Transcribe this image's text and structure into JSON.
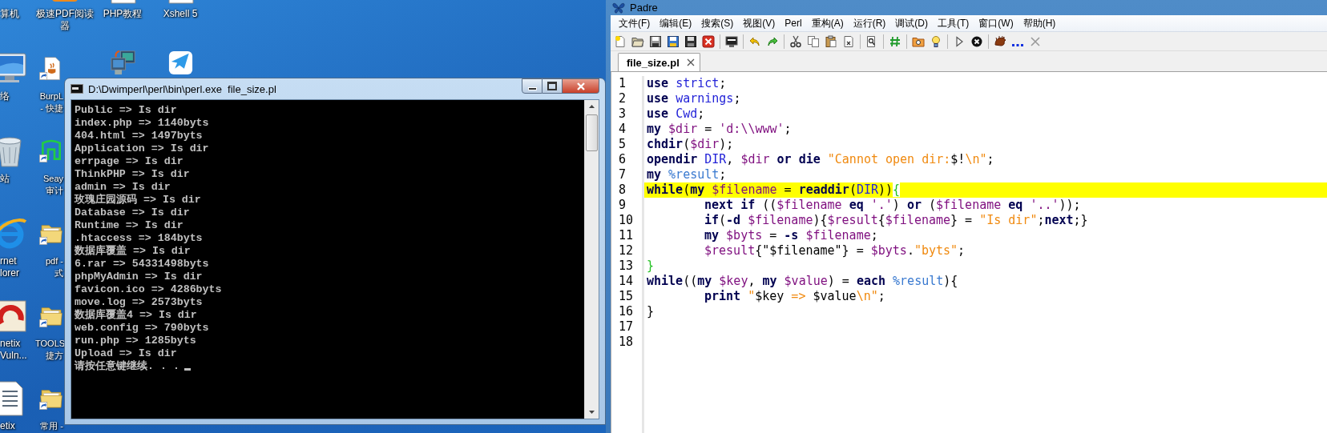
{
  "desktop": {
    "columns": [
      {
        "icons": [
          {
            "label_lines": [
              "算机"
            ]
          },
          {
            "kind": "monitor",
            "label_lines": [
              "络"
            ]
          },
          {
            "kind": "bin",
            "label_lines": [
              "站"
            ]
          },
          {
            "kind": "globe",
            "label_lines": [
              "rnet",
              "lorer"
            ]
          },
          {
            "kind": "red-app",
            "label_lines": [
              "netix",
              "Vuln..."
            ]
          },
          {
            "kind": "document",
            "label_lines": [
              "etix"
            ]
          }
        ]
      },
      {
        "icons": [
          {
            "kind": "pdf-app",
            "shortcut": false,
            "label_lines": [
              "极速PDF阅读",
              "器"
            ]
          },
          {
            "kind": "java-file",
            "shortcut": true,
            "label_lines": [
              "BurpL",
              "- 快捷"
            ]
          },
          {
            "kind": "green-app",
            "shortcut": true,
            "label_lines": [
              "Seay",
              "审计"
            ]
          },
          {
            "kind": "folder",
            "shortcut": true,
            "label_lines": [
              "pdf -",
              "式"
            ]
          },
          {
            "kind": "folder",
            "shortcut": true,
            "label_lines": [
              "TOOLS",
              "捷方"
            ]
          },
          {
            "kind": "folder",
            "shortcut": true,
            "label_lines": [
              "常用 -"
            ]
          }
        ]
      },
      {
        "icons": [
          {
            "kind": "document",
            "label_lines": [
              "PHP教程"
            ]
          },
          {
            "kind": "computer"
          }
        ]
      },
      {
        "icons": [
          {
            "kind": "document",
            "label_lines": [
              "Xshell 5"
            ]
          },
          {
            "kind": "bird"
          }
        ]
      }
    ]
  },
  "console": {
    "title": "D:\\Dwimperl\\perl\\bin\\perl.exe  file_size.pl",
    "cursor": true,
    "lines": [
      "Public => Is dir",
      "index.php => 1140byts",
      "404.html => 1497byts",
      "Application => Is dir",
      "errpage => Is dir",
      "ThinkPHP => Is dir",
      "admin => Is dir",
      "玫瑰庄园源码 => Is dir",
      "Database => Is dir",
      "Runtime => Is dir",
      ".htaccess => 184byts",
      "数据库覆盖 => Is dir",
      "6.rar => 54331498byts",
      "phpMyAdmin => Is dir",
      "favicon.ico => 4286byts",
      "move.log => 2573byts",
      "数据库覆盖4 => Is dir",
      "web.config => 790byts",
      "run.php => 1285byts",
      "Upload => Is dir",
      "请按任意键继续. . ."
    ]
  },
  "padre": {
    "title": "Padre",
    "menu": [
      "文件(F)",
      "编辑(E)",
      "搜索(S)",
      "视图(V)",
      "Perl",
      "重构(A)",
      "运行(R)",
      "调试(D)",
      "工具(T)",
      "窗口(W)",
      "帮助(H)"
    ],
    "tabs": [
      {
        "label": "file_size.pl",
        "selected": true
      }
    ],
    "lines": [
      {
        "number": "1",
        "current": false,
        "indented": false,
        "tokens": [
          {
            "text": "use ",
            "kind": "keyword"
          },
          {
            "text": "strict",
            "kind": "ident"
          },
          {
            "text": ";",
            "kind": "plain"
          }
        ]
      },
      {
        "number": "2",
        "current": false,
        "indented": false,
        "tokens": [
          {
            "text": "use ",
            "kind": "keyword"
          },
          {
            "text": "warnings",
            "kind": "ident"
          },
          {
            "text": ";",
            "kind": "plain"
          }
        ]
      },
      {
        "number": "3",
        "current": false,
        "indented": false,
        "tokens": [
          {
            "text": "use ",
            "kind": "keyword"
          },
          {
            "text": "Cwd",
            "kind": "ident"
          },
          {
            "text": ";",
            "kind": "plain"
          }
        ]
      },
      {
        "number": "4",
        "current": false,
        "indented": false,
        "tokens": [
          {
            "text": "my ",
            "kind": "keyword"
          },
          {
            "text": "$dir",
            "kind": "var"
          },
          {
            "text": " = ",
            "kind": "plain"
          },
          {
            "text": "'d:\\\\www'",
            "kind": "quote"
          },
          {
            "text": ";",
            "kind": "plain"
          }
        ]
      },
      {
        "number": "5",
        "current": false,
        "indented": false,
        "tokens": [
          {
            "text": "chdir",
            "kind": "keyword"
          },
          {
            "text": "(",
            "kind": "plain"
          },
          {
            "text": "$dir",
            "kind": "var"
          },
          {
            "text": ");",
            "kind": "plain"
          }
        ]
      },
      {
        "number": "6",
        "current": false,
        "indented": false,
        "tokens": [
          {
            "text": "opendir ",
            "kind": "keyword"
          },
          {
            "text": "DIR",
            "kind": "ident"
          },
          {
            "text": ", ",
            "kind": "plain"
          },
          {
            "text": "$dir ",
            "kind": "var"
          },
          {
            "text": "or die ",
            "kind": "keyword"
          },
          {
            "text": "\"Cannot open dir:",
            "kind": "string"
          },
          {
            "text": "$!",
            "kind": "plain"
          },
          {
            "text": "\\n\"",
            "kind": "string"
          },
          {
            "text": ";",
            "kind": "plain"
          }
        ]
      },
      {
        "number": "7",
        "current": false,
        "indented": false,
        "tokens": [
          {
            "text": "my ",
            "kind": "keyword"
          },
          {
            "text": "%result",
            "kind": "hash"
          },
          {
            "text": ";",
            "kind": "plain"
          }
        ]
      },
      {
        "number": "8",
        "current": true,
        "indented": false,
        "tokens": [
          {
            "text": "while",
            "kind": "keyword"
          },
          {
            "text": "(",
            "kind": "plain"
          },
          {
            "text": "my ",
            "kind": "keyword"
          },
          {
            "text": "$filename",
            "kind": "var"
          },
          {
            "text": " = ",
            "kind": "plain"
          },
          {
            "text": "readdir",
            "kind": "keyword"
          },
          {
            "text": "(",
            "kind": "plain"
          },
          {
            "text": "DIR",
            "kind": "ident"
          },
          {
            "text": "))",
            "kind": "plain"
          },
          {
            "text": "{",
            "kind": "brace"
          }
        ]
      },
      {
        "number": "9",
        "current": false,
        "indented": true,
        "tokens": [
          {
            "text": "next if",
            "kind": "keyword"
          },
          {
            "text": " ((",
            "kind": "plain"
          },
          {
            "text": "$filename ",
            "kind": "var"
          },
          {
            "text": "eq ",
            "kind": "keyword"
          },
          {
            "text": "'.'",
            "kind": "quote"
          },
          {
            "text": ") ",
            "kind": "plain"
          },
          {
            "text": "or",
            "kind": "keyword"
          },
          {
            "text": " (",
            "kind": "plain"
          },
          {
            "text": "$filename ",
            "kind": "var"
          },
          {
            "text": "eq ",
            "kind": "keyword"
          },
          {
            "text": "'..'",
            "kind": "quote"
          },
          {
            "text": "));",
            "kind": "plain"
          }
        ]
      },
      {
        "number": "10",
        "current": false,
        "indented": true,
        "tokens": [
          {
            "text": "if",
            "kind": "keyword"
          },
          {
            "text": "(",
            "kind": "plain"
          },
          {
            "text": "-d ",
            "kind": "keyword"
          },
          {
            "text": "$filename",
            "kind": "var"
          },
          {
            "text": "){",
            "kind": "plain"
          },
          {
            "text": "$result",
            "kind": "var"
          },
          {
            "text": "{",
            "kind": "plain"
          },
          {
            "text": "$filename",
            "kind": "var"
          },
          {
            "text": "} = ",
            "kind": "plain"
          },
          {
            "text": "\"Is dir\"",
            "kind": "string"
          },
          {
            "text": ";",
            "kind": "plain"
          },
          {
            "text": "next",
            "kind": "keyword"
          },
          {
            "text": ";}",
            "kind": "plain"
          }
        ]
      },
      {
        "number": "11",
        "current": false,
        "indented": true,
        "tokens": [
          {
            "text": "my ",
            "kind": "keyword"
          },
          {
            "text": "$byts",
            "kind": "var"
          },
          {
            "text": " = ",
            "kind": "plain"
          },
          {
            "text": "-s ",
            "kind": "keyword"
          },
          {
            "text": "$filename",
            "kind": "var"
          },
          {
            "text": ";",
            "kind": "plain"
          }
        ]
      },
      {
        "number": "12",
        "current": false,
        "indented": true,
        "tokens": [
          {
            "text": "$result",
            "kind": "var"
          },
          {
            "text": "{\"$filename\"} = ",
            "kind": "plain"
          },
          {
            "text": "$byts",
            "kind": "var"
          },
          {
            "text": ".",
            "kind": "plain"
          },
          {
            "text": "\"byts\"",
            "kind": "string"
          },
          {
            "text": ";",
            "kind": "plain"
          }
        ]
      },
      {
        "number": "13",
        "current": false,
        "indented": false,
        "tokens": [
          {
            "text": "}",
            "kind": "brace"
          }
        ]
      },
      {
        "number": "14",
        "current": false,
        "indented": false,
        "tokens": [
          {
            "text": "while",
            "kind": "keyword"
          },
          {
            "text": "((",
            "kind": "plain"
          },
          {
            "text": "my ",
            "kind": "keyword"
          },
          {
            "text": "$key",
            "kind": "var"
          },
          {
            "text": ", ",
            "kind": "plain"
          },
          {
            "text": "my ",
            "kind": "keyword"
          },
          {
            "text": "$value",
            "kind": "var"
          },
          {
            "text": ") = ",
            "kind": "plain"
          },
          {
            "text": "each ",
            "kind": "keyword"
          },
          {
            "text": "%result",
            "kind": "hash"
          },
          {
            "text": "){",
            "kind": "plain"
          }
        ]
      },
      {
        "number": "15",
        "current": false,
        "indented": true,
        "tokens": [
          {
            "text": "print ",
            "kind": "keyword"
          },
          {
            "text": "\"",
            "kind": "string"
          },
          {
            "text": "$key",
            "kind": "plain"
          },
          {
            "text": " => ",
            "kind": "string"
          },
          {
            "text": "$value",
            "kind": "plain"
          },
          {
            "text": "\\n\"",
            "kind": "string"
          },
          {
            "text": ";",
            "kind": "plain"
          }
        ]
      },
      {
        "number": "16",
        "current": false,
        "indented": false,
        "tokens": [
          {
            "text": "}",
            "kind": "plain"
          }
        ]
      },
      {
        "number": "17",
        "current": false
      },
      {
        "number": "18",
        "current": false
      }
    ]
  }
}
